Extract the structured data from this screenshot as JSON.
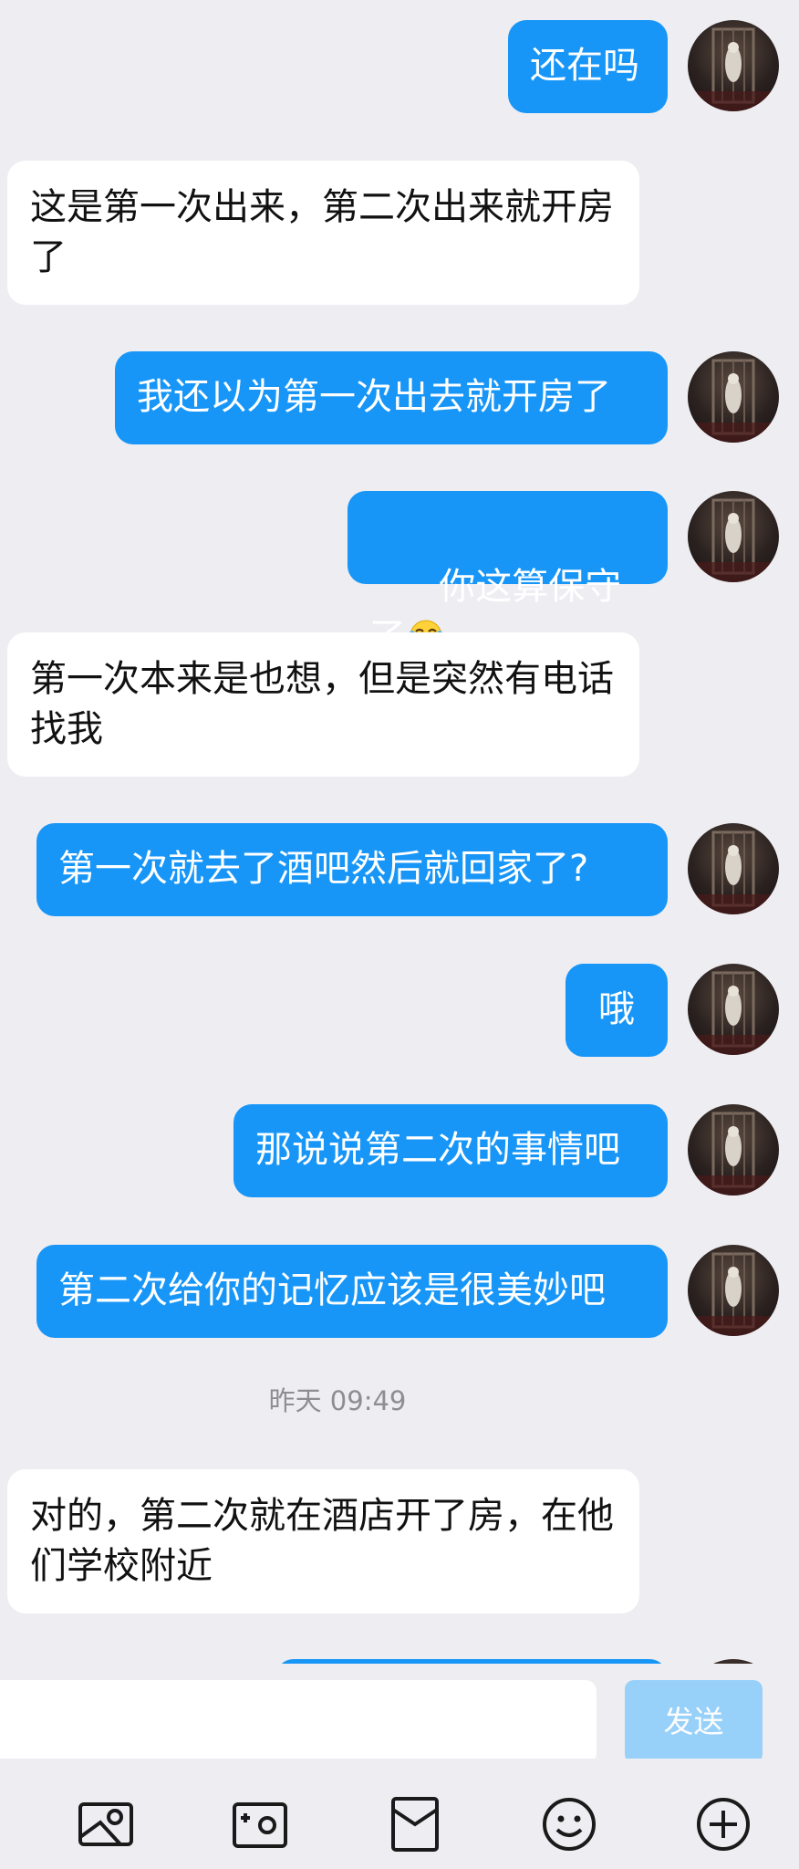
{
  "messages": [
    {
      "side": "out",
      "text": "还在吗"
    },
    {
      "side": "in",
      "text": "这是第一次出来，第二次出来就开房了"
    },
    {
      "side": "out",
      "text": "我还以为第一次出去就开房了"
    },
    {
      "side": "out",
      "text": "你这算保守了",
      "emoji": "face-with-tears-of-joy"
    },
    {
      "side": "in",
      "text": "第一次本来是也想，但是突然有电话找我"
    },
    {
      "side": "out",
      "text": "第一次就去了酒吧然后就回家了?"
    },
    {
      "side": "out",
      "text": "哦"
    },
    {
      "side": "out",
      "text": "那说说第二次的事情吧"
    },
    {
      "side": "out",
      "text": "第二次给你的记忆应该是很美妙吧"
    },
    {
      "side": "time",
      "text": "昨天 09:49"
    },
    {
      "side": "in",
      "text": "对的，第二次就在酒店开了房，在他们学校附近"
    },
    {
      "side": "out",
      "text": ""
    }
  ],
  "input": {
    "value": "",
    "placeholder": "",
    "send_label": "发送"
  },
  "toolbar": {
    "items": [
      {
        "icon": "image-icon"
      },
      {
        "icon": "camera-icon"
      },
      {
        "icon": "red-packet-icon"
      },
      {
        "icon": "emoji-icon"
      },
      {
        "icon": "plus-icon"
      }
    ]
  },
  "colors": {
    "background": "#eeedf2",
    "outgoing_bubble": "#1796f8",
    "incoming_bubble": "#ffffff",
    "send_button": "#8ecdfa",
    "timestamp_text": "#8d8d93"
  }
}
